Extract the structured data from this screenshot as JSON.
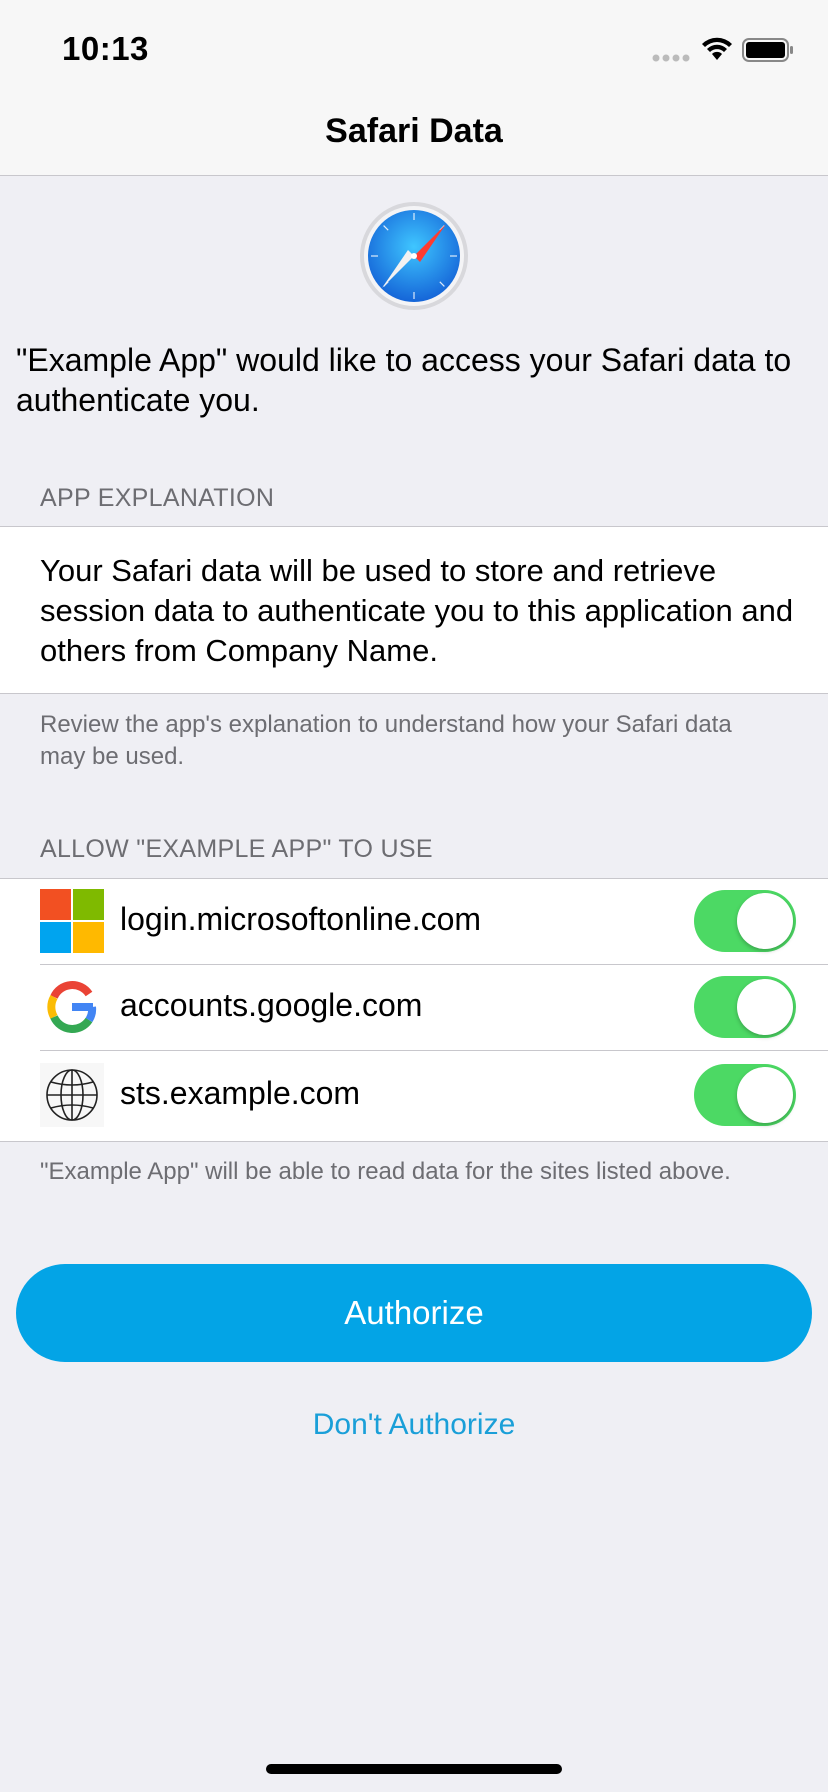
{
  "status_bar": {
    "time": "10:13"
  },
  "nav": {
    "title": "Safari Data"
  },
  "intro": {
    "text": "\"Example App\" would like to access your Safari data to authenticate you."
  },
  "explanation": {
    "header": "APP EXPLANATION",
    "body": "Your Safari data will be used to store and retrieve session data to authenticate you to this application and others from Company Name.",
    "footnote": "Review the app's explanation to understand how your Safari data may be used."
  },
  "sites": {
    "header": "ALLOW \"EXAMPLE APP\" TO USE",
    "items": [
      {
        "label": "login.microsoftonline.com",
        "icon": "microsoft-logo-icon",
        "enabled": true
      },
      {
        "label": "accounts.google.com",
        "icon": "google-logo-icon",
        "enabled": true
      },
      {
        "label": "sts.example.com",
        "icon": "globe-icon",
        "enabled": true
      }
    ],
    "footnote": "\"Example App\" will be able to read data for the sites listed above."
  },
  "actions": {
    "authorize_label": "Authorize",
    "dont_authorize_label": "Don't Authorize"
  },
  "colors": {
    "accent": "#03a4e6",
    "link": "#1a9fd8",
    "toggle_on": "#4cd964",
    "background": "#efeff4"
  }
}
